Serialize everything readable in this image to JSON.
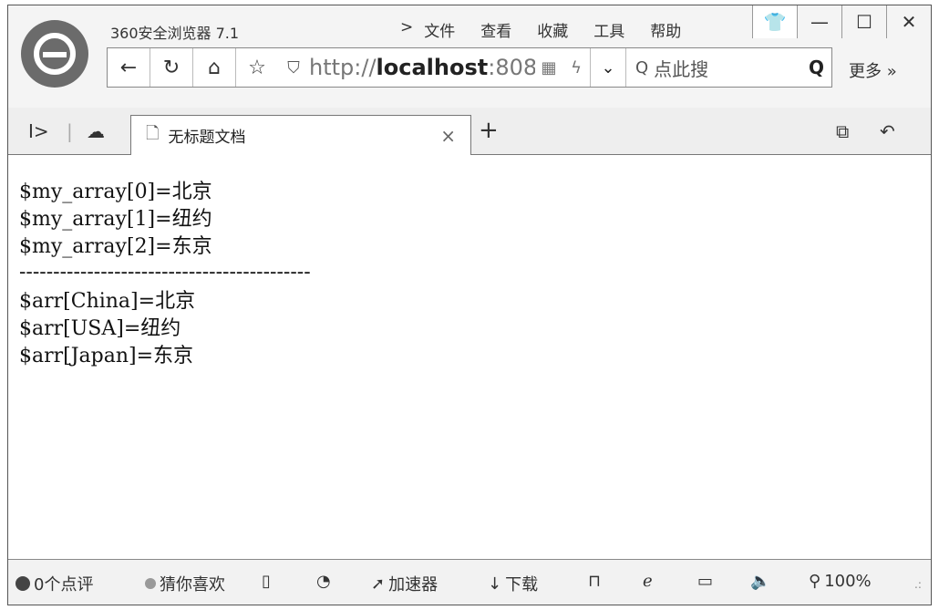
{
  "window": {
    "app_title": "360安全浏览器 7.1",
    "menu": [
      "文件",
      "查看",
      "收藏",
      "工具",
      "帮助"
    ],
    "minimize_glyph": "—",
    "maximize_glyph": "☐",
    "close_glyph": "✕"
  },
  "address_bar": {
    "url_prefix": "http://",
    "url_host": "localhost",
    "url_suffix": ":808",
    "search_placeholder": "点此搜",
    "more_label": "更多 »"
  },
  "tabs": [
    {
      "title": "无标题文档",
      "active": true
    }
  ],
  "content": {
    "lines": [
      "$my_array[0]=北京",
      "$my_array[1]=纽约",
      "$my_array[2]=东京",
      "-------------------------------------------",
      "$arr[China]=北京",
      "$arr[USA]=纽约",
      "$arr[Japan]=东京"
    ]
  },
  "status_bar": {
    "comments": "0个点评",
    "guess": "猜你喜欢",
    "accelerator": "加速器",
    "download": "下载",
    "zoom": "100%"
  },
  "icons": [
    "logo-icon",
    "back-icon",
    "refresh-icon",
    "home-icon",
    "star-icon",
    "shield-icon",
    "qr-icon",
    "bolt-icon",
    "search-icon",
    "shirt-icon",
    "sidebar-icon",
    "cloud-icon",
    "document-icon",
    "close-icon",
    "plus-icon",
    "tabs-icon",
    "undo-icon",
    "phone-icon",
    "clock-icon",
    "rocket-icon",
    "download-icon",
    "ie-icon",
    "window-icon",
    "speaker-icon",
    "zoom-icon"
  ]
}
